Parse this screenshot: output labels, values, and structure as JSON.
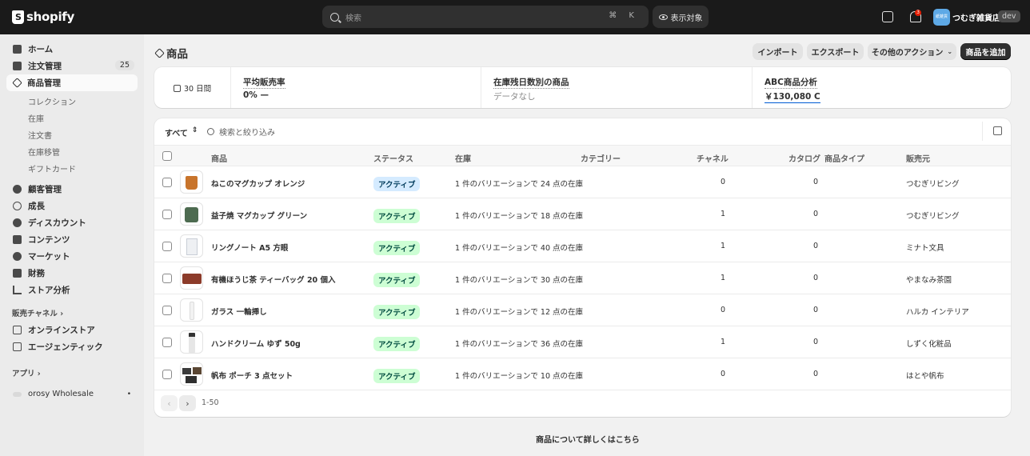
{
  "topbar": {
    "logo_text": "shopify",
    "search_placeholder": "検索",
    "search_shortcut": "⌘ K",
    "view_button": "表示対象",
    "notification_count": "3",
    "avatar_text": "紙雑貨",
    "store_name": "つむぎ雑貨店",
    "dev_badge": "dev"
  },
  "sidebar": {
    "items": [
      {
        "label": "ホーム"
      },
      {
        "label": "注文管理",
        "count": "25"
      },
      {
        "label": "商品管理"
      },
      {
        "label": "顧客管理"
      },
      {
        "label": "成長"
      },
      {
        "label": "ディスカウント"
      },
      {
        "label": "コンテンツ"
      },
      {
        "label": "マーケット"
      },
      {
        "label": "財務"
      },
      {
        "label": "ストア分析"
      }
    ],
    "sub_items": [
      "コレクション",
      "在庫",
      "注文書",
      "在庫移管",
      "ギフトカード"
    ],
    "sales_channels_title": "販売チャネル ›",
    "channels": [
      "オンラインストア",
      "エージェンティック"
    ],
    "apps_title": "アプリ ›",
    "apps": [
      "orosy Wholesale"
    ]
  },
  "header": {
    "title": "商品",
    "import": "インポート",
    "export": "エクスポート",
    "more_actions": "その他のアクション",
    "add_product": "商品を追加"
  },
  "metrics": {
    "period": "30 日間",
    "avg_sell_rate_title": "平均販売率",
    "avg_sell_rate_value": "0% —",
    "days_remaining_title": "在庫残日数別の商品",
    "days_remaining_value": "データなし",
    "abc_title": "ABC商品分析",
    "abc_value": "￥130,080 C"
  },
  "table": {
    "filter_tab": "すべて",
    "search_placeholder": "検索と絞り込み",
    "headers": {
      "product": "商品",
      "status": "ステータス",
      "inventory": "在庫",
      "category": "カテゴリー",
      "channels": "チャネル",
      "catalogs": "カタログ",
      "type": "商品タイプ",
      "vendor": "販売元"
    },
    "rows": [
      {
        "name": "ねこのマグカップ オレンジ",
        "status": "アクティブ",
        "inventory": "1 件のバリエーションで 24 点の在庫",
        "channels": "0",
        "catalogs": "0",
        "vendor": "つむぎリビング"
      },
      {
        "name": "益子焼 マグカップ グリーン",
        "status": "アクティブ",
        "inventory": "1 件のバリエーションで 18 点の在庫",
        "channels": "1",
        "catalogs": "0",
        "vendor": "つむぎリビング"
      },
      {
        "name": "リングノート A5 方眼",
        "status": "アクティブ",
        "inventory": "1 件のバリエーションで 40 点の在庫",
        "channels": "1",
        "catalogs": "0",
        "vendor": "ミナト文具"
      },
      {
        "name": "有機ほうじ茶 ティーバッグ 20 個入",
        "status": "アクティブ",
        "inventory": "1 件のバリエーションで 30 点の在庫",
        "channels": "1",
        "catalogs": "0",
        "vendor": "やまなみ茶園"
      },
      {
        "name": "ガラス 一輪挿し",
        "status": "アクティブ",
        "inventory": "1 件のバリエーションで 12 点の在庫",
        "channels": "0",
        "catalogs": "0",
        "vendor": "ハルカ インテリア"
      },
      {
        "name": "ハンドクリーム ゆず 50g",
        "status": "アクティブ",
        "inventory": "1 件のバリエーションで 36 点の在庫",
        "channels": "1",
        "catalogs": "0",
        "vendor": "しずく化粧品"
      },
      {
        "name": "帆布 ポーチ 3 点セット",
        "status": "アクティブ",
        "inventory": "1 件のバリエーションで 10 点の在庫",
        "channels": "0",
        "catalogs": "0",
        "vendor": "はとや帆布"
      }
    ],
    "pagination": "1-50"
  },
  "footer_link": "商品について詳しくはこちら"
}
